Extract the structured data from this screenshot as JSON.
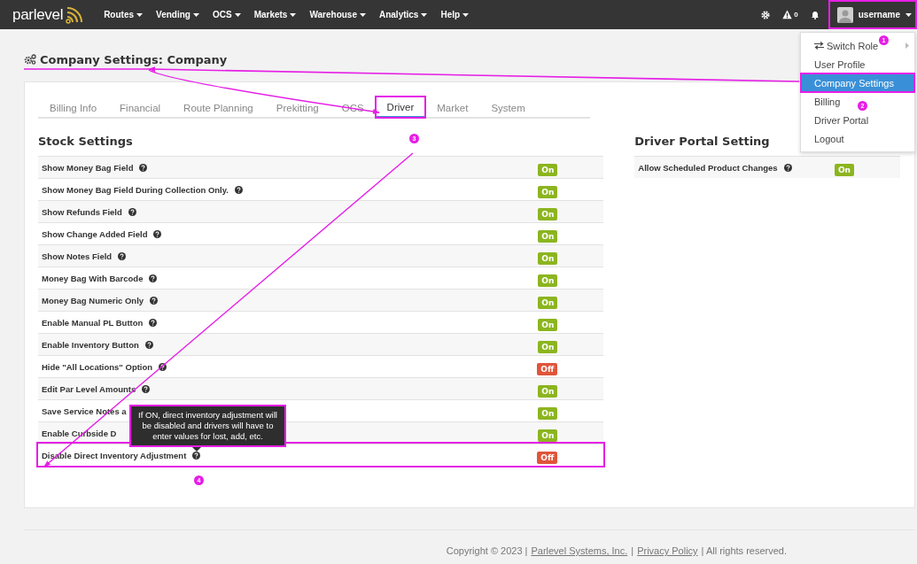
{
  "navbar": {
    "logo": "parlevel",
    "menus": [
      "Routes",
      "Vending",
      "OCS",
      "Markets",
      "Warehouse",
      "Analytics",
      "Help"
    ],
    "alert_count": "0",
    "username": "username",
    "annotated": true
  },
  "user_menu": {
    "items": [
      {
        "label": "Switch Role",
        "kind": "submenu",
        "selected": false
      },
      {
        "label": "User Profile",
        "kind": "link",
        "selected": false
      },
      {
        "label": "Company Settings",
        "kind": "link",
        "selected": true
      },
      {
        "label": "Billing",
        "kind": "link",
        "selected": false
      },
      {
        "label": "Driver Portal",
        "kind": "link",
        "selected": false
      },
      {
        "label": "Logout",
        "kind": "link",
        "selected": false
      }
    ]
  },
  "page_title": "Company Settings: Company",
  "tabs": [
    {
      "label": "Billing Info",
      "selected": false
    },
    {
      "label": "Financial",
      "selected": false
    },
    {
      "label": "Route Planning",
      "selected": false
    },
    {
      "label": "Prekitting",
      "selected": false
    },
    {
      "label": "OCS",
      "selected": false
    },
    {
      "label": "Driver",
      "selected": true
    },
    {
      "label": "Market",
      "selected": false
    },
    {
      "label": "System",
      "selected": false
    }
  ],
  "stock_settings": {
    "heading": "Stock Settings",
    "rows": [
      {
        "label": "Show Money Bag Field",
        "help": true,
        "on": true,
        "toggle": "On",
        "annotated": false
      },
      {
        "label": "Show Money Bag Field During Collection Only.",
        "help": true,
        "on": true,
        "toggle": "On",
        "annotated": false
      },
      {
        "label": "Show Refunds Field",
        "help": true,
        "on": true,
        "toggle": "On",
        "annotated": false
      },
      {
        "label": "Show Change Added Field",
        "help": true,
        "on": true,
        "toggle": "On",
        "annotated": false
      },
      {
        "label": "Show Notes Field",
        "help": true,
        "on": true,
        "toggle": "On",
        "annotated": false
      },
      {
        "label": "Money Bag With Barcode",
        "help": true,
        "on": true,
        "toggle": "On",
        "annotated": false
      },
      {
        "label": "Money Bag Numeric Only",
        "help": true,
        "on": true,
        "toggle": "On",
        "annotated": false
      },
      {
        "label": "Enable Manual PL Button",
        "help": true,
        "on": true,
        "toggle": "On",
        "annotated": false
      },
      {
        "label": "Enable Inventory Button",
        "help": true,
        "on": true,
        "toggle": "On",
        "annotated": false
      },
      {
        "label": "Hide \"All Locations\" Option",
        "help": true,
        "on": false,
        "toggle": "Off",
        "annotated": false
      },
      {
        "label": "Edit Par Level Amounts",
        "help": true,
        "on": true,
        "toggle": "On",
        "annotated": false
      },
      {
        "label": "Save Service Notes a",
        "help": false,
        "on": true,
        "toggle": "On",
        "annotated": false
      },
      {
        "label": "Enable Curbside D",
        "help": false,
        "on": true,
        "toggle": "On",
        "annotated": false
      },
      {
        "label": "Disable Direct Inventory Adjustment",
        "help": true,
        "on": false,
        "toggle": "Off",
        "annotated": true
      }
    ]
  },
  "driver_portal": {
    "heading": "Driver Portal Setting",
    "rows": [
      {
        "label": "Allow Scheduled Product Changes",
        "help": true,
        "on": true,
        "toggle": "On",
        "annotated": false
      }
    ]
  },
  "tooltip": {
    "text": "If ON, direct inventory adjustment will be disabled and drivers will have to enter values for lost, add, etc."
  },
  "annotation_badges": [
    "1",
    "2",
    "3",
    "4"
  ],
  "footer": {
    "copyright": "Copyright © 2023 |",
    "company_link": "Parlevel Systems, Inc.",
    "separator": "|",
    "privacy_link": "Privacy Policy",
    "rights": "| All rights reserved."
  }
}
